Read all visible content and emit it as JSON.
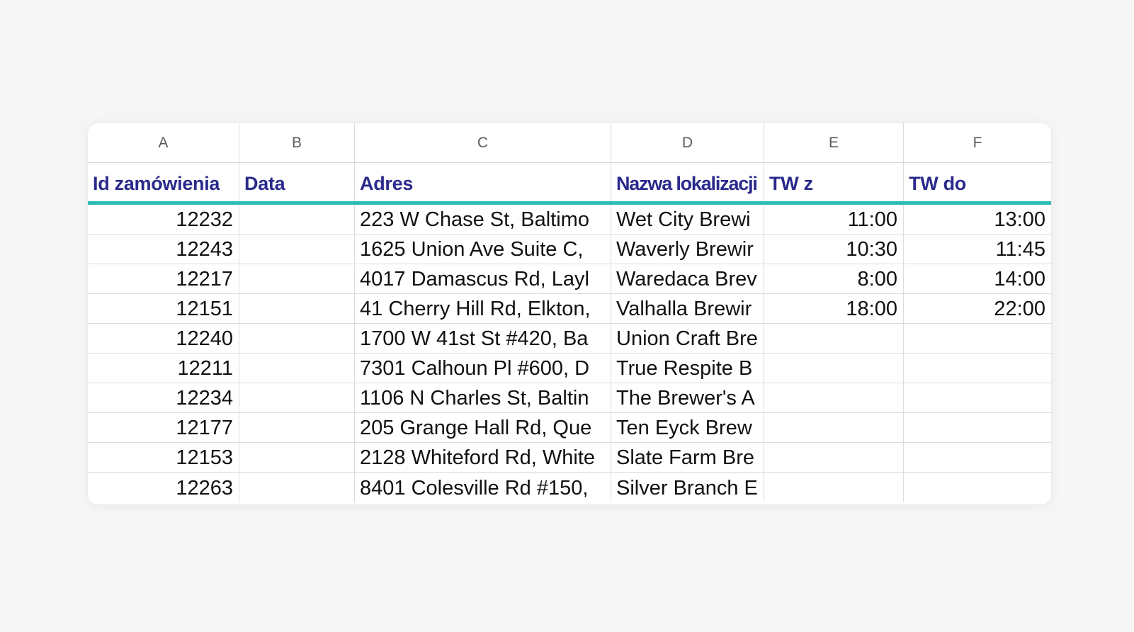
{
  "sheet": {
    "column_letters": [
      "A",
      "B",
      "C",
      "D",
      "E",
      "F"
    ],
    "headers": [
      "Id zamówienia",
      "Data",
      "Adres",
      "Nazwa lokalizacji",
      "TW z",
      "TW do"
    ],
    "rows": [
      {
        "id": "12232",
        "data": "",
        "adres": "223 W Chase St, Baltimo",
        "nazwa": "Wet City Brewi",
        "tw_z": "11:00",
        "tw_do": "13:00"
      },
      {
        "id": "12243",
        "data": "",
        "adres": "1625 Union Ave Suite C,",
        "nazwa": "Waverly Brewir",
        "tw_z": "10:30",
        "tw_do": "11:45"
      },
      {
        "id": "12217",
        "data": "",
        "adres": "4017 Damascus Rd, Layl",
        "nazwa": "Waredaca Brev",
        "tw_z": "8:00",
        "tw_do": "14:00"
      },
      {
        "id": "12151",
        "data": "",
        "adres": "41 Cherry Hill Rd, Elkton,",
        "nazwa": "Valhalla Brewir",
        "tw_z": "18:00",
        "tw_do": "22:00"
      },
      {
        "id": "12240",
        "data": "",
        "adres": "1700 W 41st St #420, Ba",
        "nazwa": "Union Craft Bre",
        "tw_z": "",
        "tw_do": ""
      },
      {
        "id": "12211",
        "data": "",
        "adres": "7301 Calhoun Pl #600, D",
        "nazwa": "True Respite B",
        "tw_z": "",
        "tw_do": ""
      },
      {
        "id": "12234",
        "data": "",
        "adres": "1106 N Charles St, Baltin",
        "nazwa": "The Brewer's A",
        "tw_z": "",
        "tw_do": ""
      },
      {
        "id": "12177",
        "data": "",
        "adres": "205 Grange Hall Rd, Que",
        "nazwa": "Ten Eyck Brew",
        "tw_z": "",
        "tw_do": ""
      },
      {
        "id": "12153",
        "data": "",
        "adres": "2128 Whiteford Rd, White",
        "nazwa": "Slate Farm Bre",
        "tw_z": "",
        "tw_do": ""
      },
      {
        "id": "12263",
        "data": "",
        "adres": "8401 Colesville Rd #150,",
        "nazwa": "Silver Branch E",
        "tw_z": "",
        "tw_do": ""
      }
    ]
  },
  "colors": {
    "header_text": "#2a2a8c",
    "header_rule": "#2fbcb5",
    "background": "#f6f6f6",
    "cell_text": "#111111"
  }
}
